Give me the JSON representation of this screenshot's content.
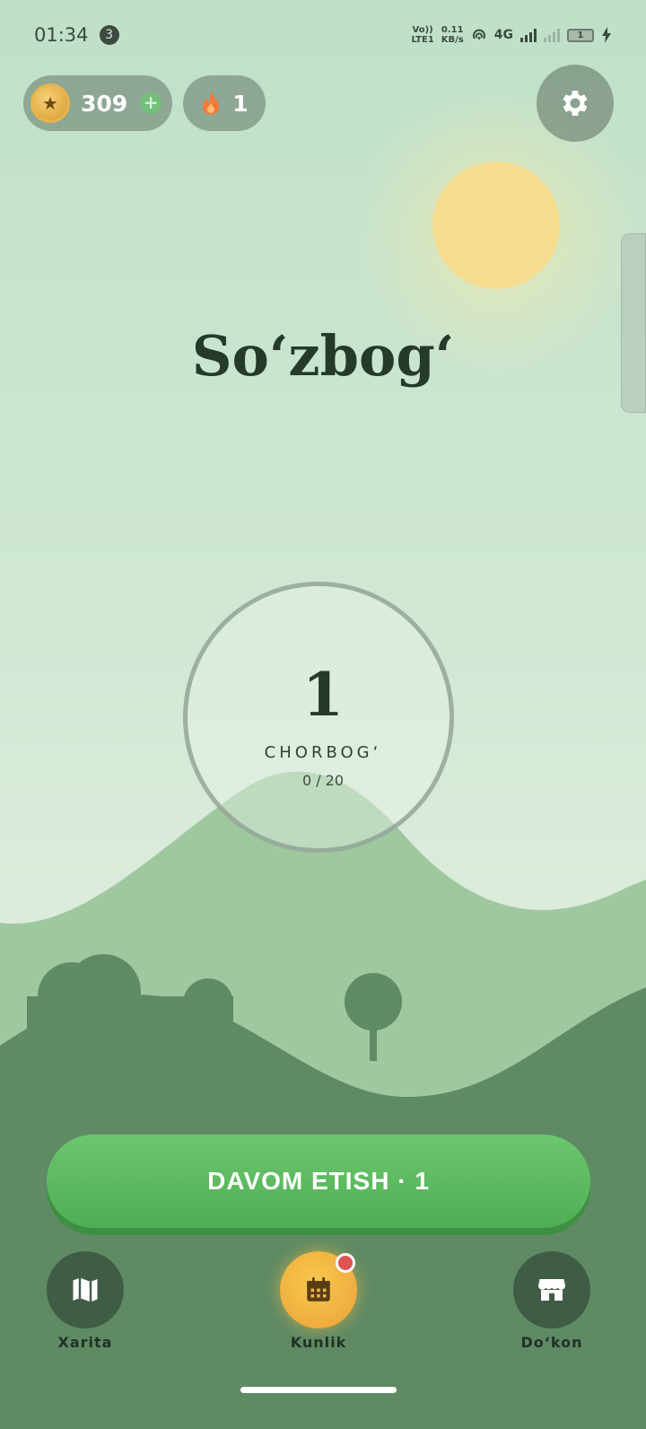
{
  "status_bar": {
    "time": "01:34",
    "notification_count": "3",
    "volte": "Vo))",
    "lte": "LTE1",
    "speed_value": "0.11",
    "speed_unit": "KB/s",
    "network": "4G",
    "battery": "1"
  },
  "header": {
    "coins": "309",
    "coin_add": "+",
    "streak": "1"
  },
  "title": "So‘zbog‘",
  "level": {
    "number": "1",
    "name": "CHORBOG‘",
    "progress_text": "0 / 20"
  },
  "cta": {
    "label": "DAVOM ETISH · 1"
  },
  "bottom_nav": {
    "items": [
      {
        "label": "Xarita",
        "icon": "map-icon"
      },
      {
        "label": "Kunlik",
        "icon": "calendar-icon"
      },
      {
        "label": "Do‘kon",
        "icon": "store-icon"
      }
    ]
  },
  "colors": {
    "accent_green": "#5cbb60",
    "accent_gold": "#f0b040",
    "dark_green": "#3f5c45",
    "hill_dark": "#5f8a64",
    "hill_light": "#9fc89f",
    "sun": "#f5dc8f"
  }
}
